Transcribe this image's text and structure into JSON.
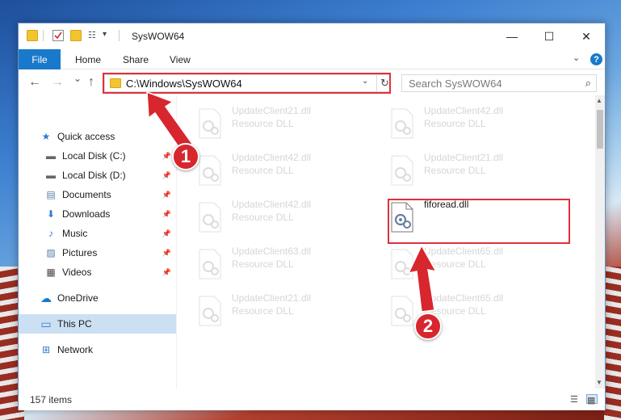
{
  "window": {
    "title": "SysWOW64",
    "controls": {
      "minimize": "—",
      "maximize": "☐",
      "close": "✕"
    }
  },
  "ribbon": {
    "tabs": [
      "File",
      "Home",
      "Share",
      "View"
    ],
    "help": "?"
  },
  "navigation": {
    "back": "←",
    "forward": "→",
    "recent": "⌄",
    "up": "↑",
    "address": "C:\\Windows\\SysWOW64",
    "dropdown": "⌄",
    "refresh": "↻",
    "search_placeholder": "Search SysWOW64",
    "search_icon": "⌕"
  },
  "sidebar": {
    "items": [
      {
        "label": "Quick access",
        "icon": "star-icon",
        "glyph": "★",
        "pinned": false
      },
      {
        "label": "Local Disk (C:)",
        "icon": "drive-icon",
        "glyph": "▬",
        "pinned": true
      },
      {
        "label": "Local Disk (D:)",
        "icon": "drive-icon",
        "glyph": "▬",
        "pinned": true
      },
      {
        "label": "Documents",
        "icon": "documents-icon",
        "glyph": "▤",
        "pinned": true
      },
      {
        "label": "Downloads",
        "icon": "downloads-icon",
        "glyph": "⬇",
        "pinned": true
      },
      {
        "label": "Music",
        "icon": "music-icon",
        "glyph": "♪",
        "pinned": true
      },
      {
        "label": "Pictures",
        "icon": "pictures-icon",
        "glyph": "▨",
        "pinned": true
      },
      {
        "label": "Videos",
        "icon": "videos-icon",
        "glyph": "▦",
        "pinned": true
      },
      {
        "label": "OneDrive",
        "icon": "cloud-icon",
        "glyph": "☁",
        "pinned": false
      },
      {
        "label": "This PC",
        "icon": "computer-icon",
        "glyph": "▭",
        "pinned": false,
        "selected": true
      },
      {
        "label": "Network",
        "icon": "network-icon",
        "glyph": "⊞",
        "pinned": false
      }
    ],
    "pin_glyph": "📌"
  },
  "files": [
    {
      "name": "UpdateClient21.dll",
      "type": "Resource DLL"
    },
    {
      "name": "UpdateClient42.dll",
      "type": "Resource DLL"
    },
    {
      "name": "UpdateClient42.dll",
      "type": "Resource DLL"
    },
    {
      "name": "UpdateClient21.dll",
      "type": "Resource DLL"
    },
    {
      "name": "UpdateClient42.dll",
      "type": "Resource DLL"
    },
    {
      "name": "fiforead.dll",
      "type": ""
    },
    {
      "name": "UpdateClient63.dll",
      "type": "Resource DLL"
    },
    {
      "name": "UpdateClient65.dll",
      "type": "Resource DLL"
    },
    {
      "name": "UpdateClient21.dll",
      "type": "Resource DLL"
    },
    {
      "name": "UpdateClient65.dll",
      "type": "Resource DLL"
    }
  ],
  "status": {
    "item_count": "157 items"
  },
  "callouts": [
    "1",
    "2"
  ],
  "colors": {
    "accent": "#1979ca",
    "highlight": "#e0313b",
    "selection": "#cce0f4"
  }
}
